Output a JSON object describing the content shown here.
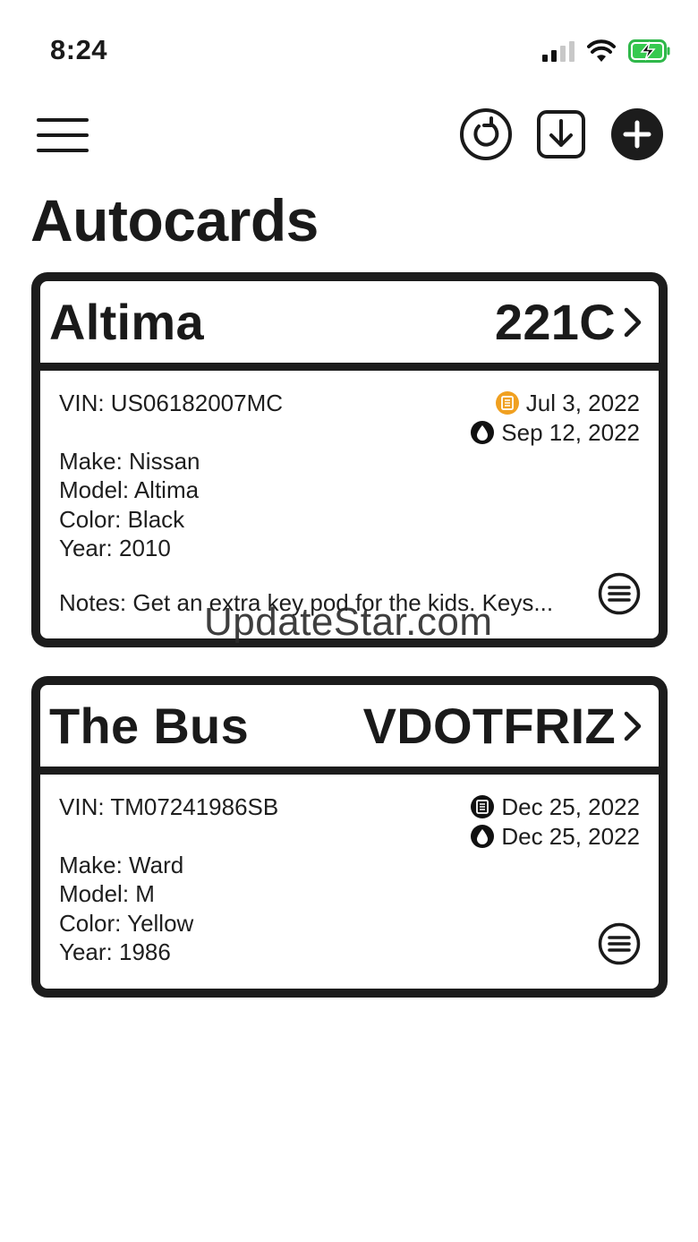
{
  "status_bar": {
    "time": "8:24"
  },
  "page": {
    "title": "Autocards"
  },
  "labels": {
    "vin": "VIN: ",
    "make": "Make: ",
    "model": "Model: ",
    "color": "Color: ",
    "year": "Year: ",
    "notes": "Notes: "
  },
  "cards": [
    {
      "name": "Altima",
      "plate": "221C",
      "vin": "US06182007MC",
      "make": "Nissan",
      "model": "Altima",
      "color": "Black",
      "year": "2010",
      "notes": "Get an extra key pod for the kids. Keys...",
      "registration_date": "Jul 3, 2022",
      "oil_date": "Sep 12, 2022",
      "registration_icon_color": "#f0a020"
    },
    {
      "name": "The Bus",
      "plate": "VDOTFRIZ",
      "vin": "TM07241986SB",
      "make": "Ward",
      "model": "M",
      "color": "Yellow",
      "year": "1986",
      "registration_date": "Dec 25, 2022",
      "oil_date": "Dec 25, 2022",
      "registration_icon_color": "#111111"
    }
  ],
  "icons": {
    "menu": "hamburger-icon",
    "sync": "refresh-icon",
    "import": "download-icon",
    "add": "plus-icon",
    "registration": "document-icon",
    "oil": "oil-drop-icon",
    "card_menu": "list-icon",
    "chevron": "chevron-right-icon"
  },
  "watermark": "UpdateStar.com"
}
